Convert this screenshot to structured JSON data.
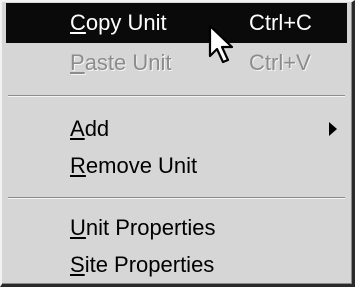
{
  "menu": {
    "items": [
      {
        "key": "C",
        "rest": "opy Unit",
        "shortcut": "Ctrl+C",
        "state": "selected"
      },
      {
        "key": "P",
        "rest": "aste Unit",
        "shortcut": "Ctrl+V",
        "state": "disabled"
      },
      {
        "key": "A",
        "rest": "dd",
        "submenu": true,
        "state": "normal"
      },
      {
        "key": "R",
        "rest": "emove Unit",
        "state": "normal"
      },
      {
        "key": "U",
        "rest": "nit Properties",
        "state": "normal"
      },
      {
        "key": "S",
        "rest": "ite Properties",
        "state": "normal"
      }
    ]
  },
  "icons": {
    "cursor": "mouse-pointer-icon",
    "submenu_arrow": "chevron-right-icon"
  }
}
